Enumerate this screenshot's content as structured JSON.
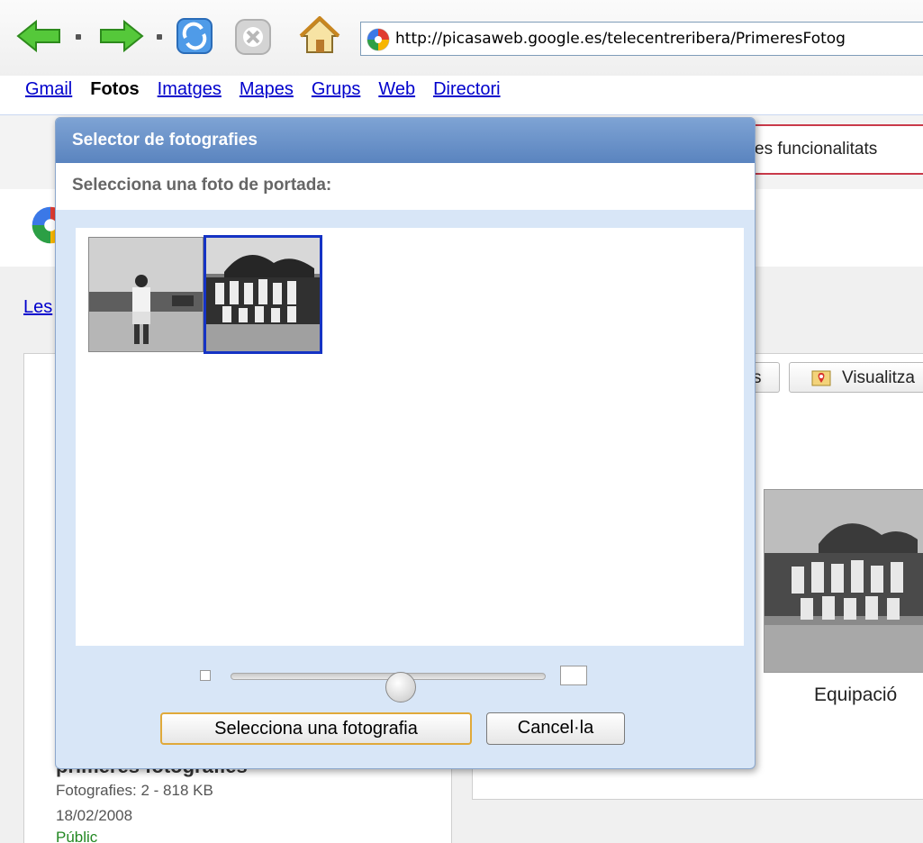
{
  "browser": {
    "url": "http://picasaweb.google.es/telecentreribera/PrimeresFotog",
    "icons": [
      "back-icon",
      "forward-icon",
      "refresh-icon",
      "stop-icon",
      "home-icon",
      "picasa-favicon"
    ]
  },
  "google_nav": {
    "links": [
      {
        "label": "Gmail",
        "active": false
      },
      {
        "label": "Fotos",
        "active": true
      },
      {
        "label": "Imatges",
        "active": false
      },
      {
        "label": "Mapes",
        "active": false
      },
      {
        "label": "Grups",
        "active": false
      },
      {
        "label": "Web",
        "active": false
      },
      {
        "label": "Directori",
        "active": false
      }
    ]
  },
  "background": {
    "infobar_text": "es funcionalitats",
    "left_link": "Les",
    "stub_button_text": "s",
    "map_button_label": "Visualitza",
    "photo_caption": "Equipació",
    "album_title": "primeres fotografies",
    "album_count": "Fotografies: 2 - 818 KB",
    "album_date": "18/02/2008",
    "album_visibility": "Públic"
  },
  "dialog": {
    "title": "Selector de fotografies",
    "subtitle": "Selecciona una foto de portada:",
    "thumbnails": [
      {
        "name": "photo-1",
        "selected": false
      },
      {
        "name": "photo-2",
        "selected": true
      }
    ],
    "zoom_level": 0.54,
    "select_button": "Selecciona una fotografia",
    "cancel_button": "Cancel·la"
  },
  "colors": {
    "dialog_title_bg": "#6f95cc",
    "dialog_bg": "#d8e6f7",
    "selected_border": "#1533c4",
    "link": "#0000cc"
  }
}
